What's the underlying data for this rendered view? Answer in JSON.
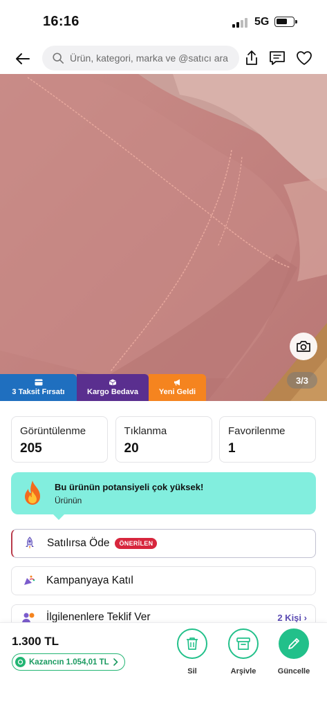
{
  "status_bar": {
    "time": "16:16",
    "network": "5G"
  },
  "header": {
    "search_placeholder": "Ürün, kategori, marka ve @satıcı ara"
  },
  "gallery": {
    "counter": "3/3",
    "badges": [
      {
        "label": "3 Taksit Fırsatı",
        "color": "#1f6fbf"
      },
      {
        "label": "Kargo Bedava",
        "color": "#5a2f8f"
      },
      {
        "label": "Yeni Geldi",
        "color": "#f5841f"
      }
    ]
  },
  "stats": [
    {
      "label": "Görüntülenme",
      "value": "205"
    },
    {
      "label": "Tıklanma",
      "value": "20"
    },
    {
      "label": "Favorilenme",
      "value": "1"
    }
  ],
  "potential_banner": {
    "title": "Bu ürünün potansiyeli çok yüksek!",
    "subtitle": "Ürünün",
    "color": "#82eede"
  },
  "actions": {
    "sell": {
      "label": "Satılırsa Öde",
      "badge": "ÖNERİLEN"
    },
    "campaign": {
      "label": "Kampanyaya Katıl"
    },
    "offer": {
      "label": "İlgilenenlere Teklif Ver",
      "count": "2 Kişi"
    }
  },
  "bottom_bar": {
    "price": "1.300 TL",
    "earning": "Kazancın 1.054,01 TL",
    "delete_label": "Sil",
    "archive_label": "Arşivle",
    "update_label": "Güncelle",
    "accent_color": "#22c08a"
  }
}
